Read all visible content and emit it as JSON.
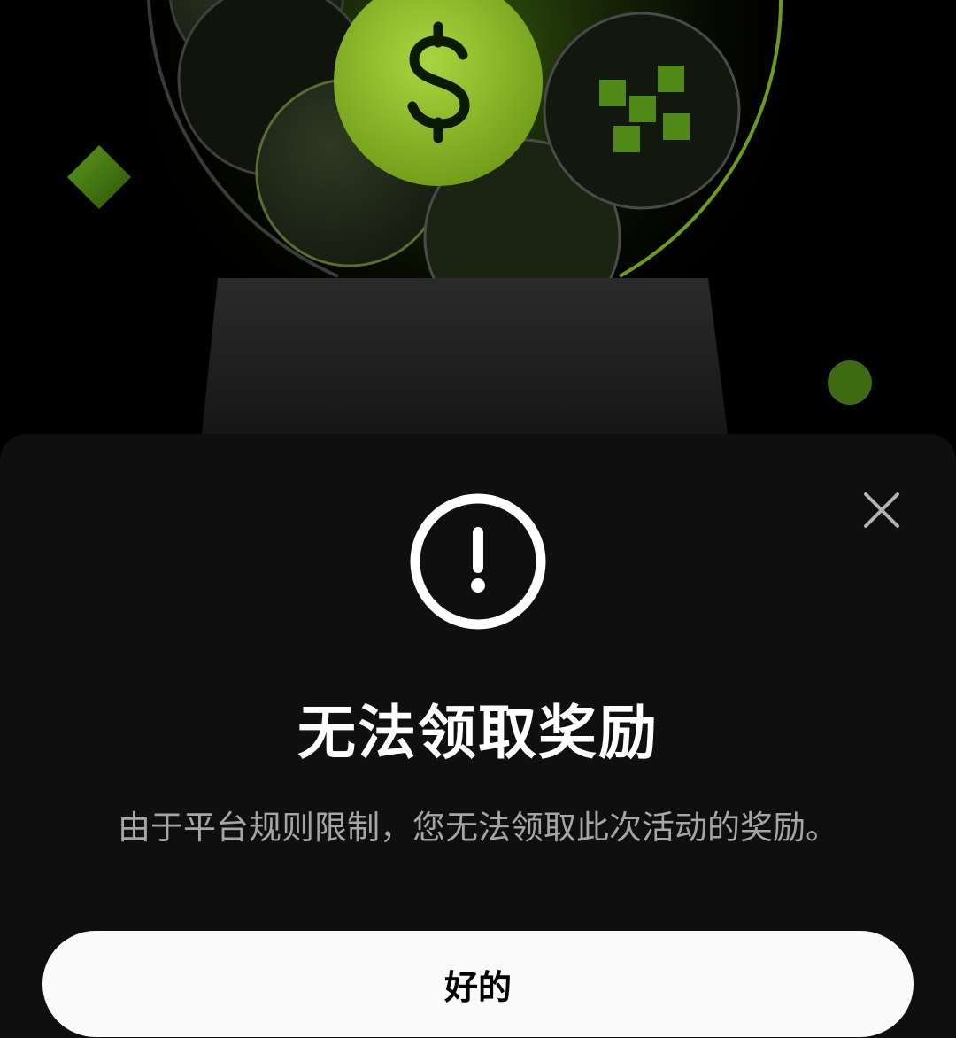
{
  "dialog": {
    "title": "无法领取奖励",
    "message": "由于平台规则限制，您无法领取此次活动的奖励。",
    "confirm_label": "好的",
    "close_icon": "close-icon",
    "status_icon": "exclamation-circle-icon"
  },
  "hero": {
    "coin_symbol": "$",
    "icons": [
      "dollar-coin-icon",
      "okx-logo-coin-icon",
      "diamond-decoration",
      "dot-decoration",
      "jar-illustration"
    ]
  },
  "colors": {
    "page_background": "#000000",
    "sheet_background": "#0f0f0f",
    "accent_green": "#a7e033",
    "title_text": "#ffffff",
    "message_text": "#a6a6a6",
    "button_background": "#fafafa",
    "button_text": "#000000"
  }
}
